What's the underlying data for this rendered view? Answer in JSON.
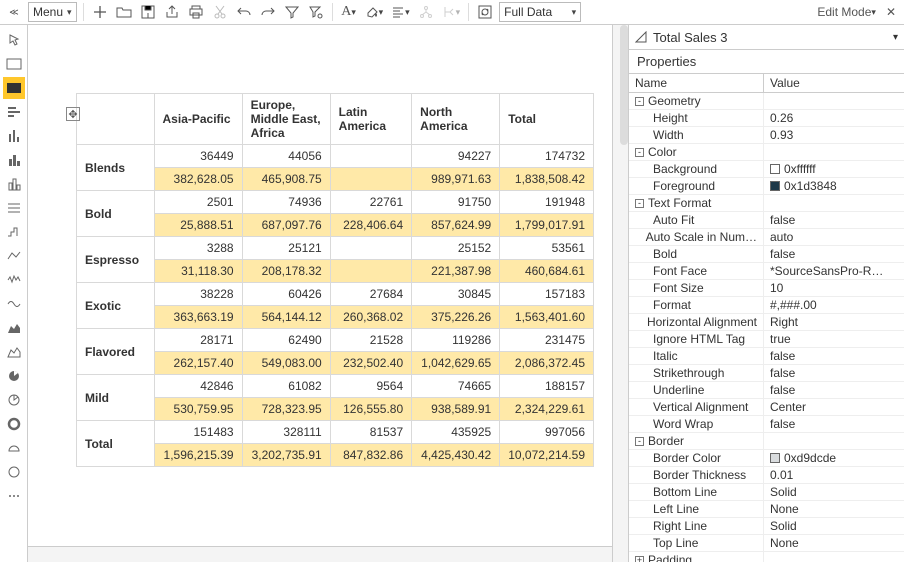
{
  "topbar": {
    "menu_label": "Menu",
    "fulldata_label": "Full Data",
    "edit_mode_label": "Edit Mode"
  },
  "table": {
    "columns": [
      "Asia-Pacific",
      "Europe, Middle East, Africa",
      "Latin America",
      "North America",
      "Total"
    ],
    "rows": [
      {
        "name": "Blends",
        "count": [
          "36449",
          "44056",
          "",
          "94227",
          "174732"
        ],
        "value": [
          "382,628.05",
          "465,908.75",
          "",
          "989,971.63",
          "1,838,508.42"
        ]
      },
      {
        "name": "Bold",
        "count": [
          "2501",
          "74936",
          "22761",
          "91750",
          "191948"
        ],
        "value": [
          "25,888.51",
          "687,097.76",
          "228,406.64",
          "857,624.99",
          "1,799,017.91"
        ]
      },
      {
        "name": "Espresso",
        "count": [
          "3288",
          "25121",
          "",
          "25152",
          "53561"
        ],
        "value": [
          "31,118.30",
          "208,178.32",
          "",
          "221,387.98",
          "460,684.61"
        ]
      },
      {
        "name": "Exotic",
        "count": [
          "38228",
          "60426",
          "27684",
          "30845",
          "157183"
        ],
        "value": [
          "363,663.19",
          "564,144.12",
          "260,368.02",
          "375,226.26",
          "1,563,401.60"
        ]
      },
      {
        "name": "Flavored",
        "count": [
          "28171",
          "62490",
          "21528",
          "119286",
          "231475"
        ],
        "value": [
          "262,157.40",
          "549,083.00",
          "232,502.40",
          "1,042,629.65",
          "2,086,372.45"
        ]
      },
      {
        "name": "Mild",
        "count": [
          "42846",
          "61082",
          "9564",
          "74665",
          "188157"
        ],
        "value": [
          "530,759.95",
          "728,323.95",
          "126,555.80",
          "938,589.91",
          "2,324,229.61"
        ]
      },
      {
        "name": "Total",
        "count": [
          "151483",
          "328111",
          "81537",
          "435925",
          "997056"
        ],
        "value": [
          "1,596,215.39",
          "3,202,735.91",
          "847,832.86",
          "4,425,430.42",
          "10,072,214.59"
        ]
      }
    ]
  },
  "panel": {
    "title": "Total Sales 3",
    "section": "Properties",
    "col_name": "Name",
    "col_value": "Value",
    "groups": [
      {
        "label": "Geometry",
        "props": [
          {
            "name": "Height",
            "value": "0.26"
          },
          {
            "name": "Width",
            "value": "0.93"
          }
        ]
      },
      {
        "label": "Color",
        "props": [
          {
            "name": "Background",
            "value": "0xffffff",
            "swatch": "#ffffff"
          },
          {
            "name": "Foreground",
            "value": "0x1d3848",
            "swatch": "#1d3848"
          }
        ]
      },
      {
        "label": "Text Format",
        "props": [
          {
            "name": "Auto Fit",
            "value": "false"
          },
          {
            "name": "Auto Scale in Num…",
            "value": "auto"
          },
          {
            "name": "Bold",
            "value": "false"
          },
          {
            "name": "Font Face",
            "value": "*SourceSansPro-R…"
          },
          {
            "name": "Font Size",
            "value": "10"
          },
          {
            "name": "Format",
            "value": "#,###.00"
          },
          {
            "name": "Horizontal Alignment",
            "value": "Right"
          },
          {
            "name": "Ignore HTML Tag",
            "value": "true"
          },
          {
            "name": "Italic",
            "value": "false"
          },
          {
            "name": "Strikethrough",
            "value": "false"
          },
          {
            "name": "Underline",
            "value": "false"
          },
          {
            "name": "Vertical Alignment",
            "value": "Center"
          },
          {
            "name": "Word Wrap",
            "value": "false"
          }
        ]
      },
      {
        "label": "Border",
        "props": [
          {
            "name": "Border Color",
            "value": "0xd9dcde",
            "swatch": "#d9dcde"
          },
          {
            "name": "Border Thickness",
            "value": "0.01"
          },
          {
            "name": "Bottom Line",
            "value": "Solid"
          },
          {
            "name": "Left Line",
            "value": "None"
          },
          {
            "name": "Right Line",
            "value": "Solid"
          },
          {
            "name": "Top Line",
            "value": "None"
          }
        ]
      },
      {
        "label": "Padding",
        "props": []
      }
    ]
  }
}
